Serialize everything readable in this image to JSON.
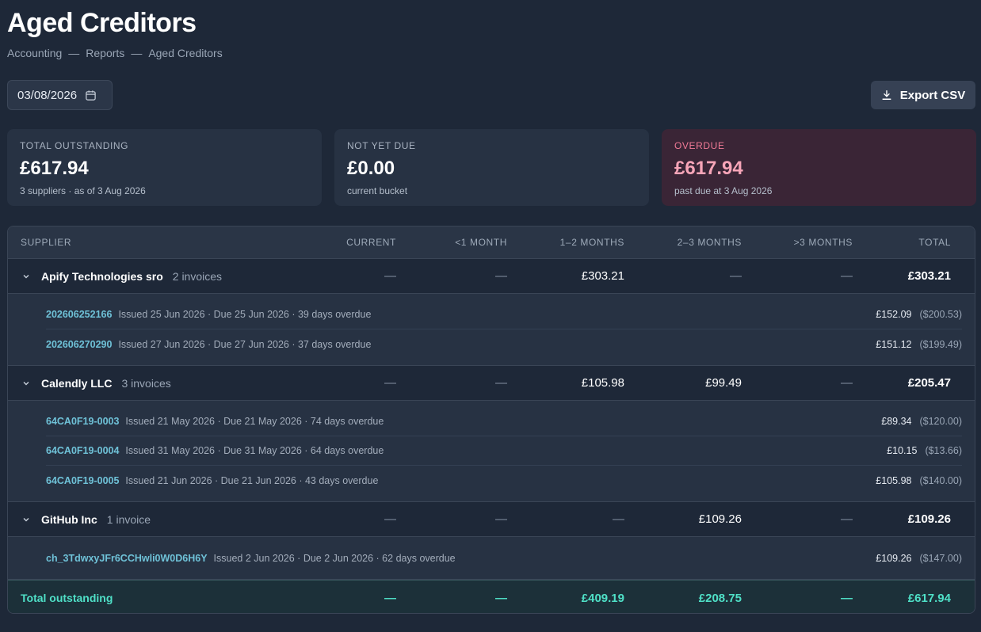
{
  "title": "Aged Creditors",
  "breadcrumb": [
    "Accounting",
    "—",
    "Reports",
    "—",
    "Aged Creditors"
  ],
  "date_value": "03/08/2026",
  "export_label": "Export CSV",
  "cards": [
    {
      "label": "TOTAL OUTSTANDING",
      "value": "£617.94",
      "sub": "3 suppliers · as of 3 Aug 2026"
    },
    {
      "label": "NOT YET DUE",
      "value": "£0.00",
      "sub": "current bucket"
    },
    {
      "label": "OVERDUE",
      "value": "£617.94",
      "sub": "past due at 3 Aug 2026"
    }
  ],
  "columns": [
    "SUPPLIER",
    "CURRENT",
    "<1 MONTH",
    "1–2 MONTHS",
    "2–3 MONTHS",
    ">3 MONTHS",
    "TOTAL"
  ],
  "groups": [
    {
      "name": "Apify Technologies sro",
      "count": "2 invoices",
      "current": "—",
      "lt1": "—",
      "m12": "£303.21",
      "m23": "—",
      "m3p": "—",
      "total": "£303.21",
      "invoices": [
        {
          "id": "202606252166",
          "meta": "Issued 25 Jun 2026 · Due 25 Jun 2026 · 39 days overdue",
          "amount": "£152.09",
          "usd": "($200.53)"
        },
        {
          "id": "202606270290",
          "meta": "Issued 27 Jun 2026 · Due 27 Jun 2026 · 37 days overdue",
          "amount": "£151.12",
          "usd": "($199.49)"
        }
      ]
    },
    {
      "name": "Calendly LLC",
      "count": "3 invoices",
      "current": "—",
      "lt1": "—",
      "m12": "£105.98",
      "m23": "£99.49",
      "m3p": "—",
      "total": "£205.47",
      "invoices": [
        {
          "id": "64CA0F19-0003",
          "meta": "Issued 21 May 2026 · Due 21 May 2026 · 74 days overdue",
          "amount": "£89.34",
          "usd": "($120.00)"
        },
        {
          "id": "64CA0F19-0004",
          "meta": "Issued 31 May 2026 · Due 31 May 2026 · 64 days overdue",
          "amount": "£10.15",
          "usd": "($13.66)"
        },
        {
          "id": "64CA0F19-0005",
          "meta": "Issued 21 Jun 2026 · Due 21 Jun 2026 · 43 days overdue",
          "amount": "£105.98",
          "usd": "($140.00)"
        }
      ]
    },
    {
      "name": "GitHub Inc",
      "count": "1 invoice",
      "current": "—",
      "lt1": "—",
      "m12": "—",
      "m23": "£109.26",
      "m3p": "—",
      "total": "£109.26",
      "invoices": [
        {
          "id": "ch_3TdwxyJFr6CCHwli0W0D6H6Y",
          "meta": "Issued 2 Jun 2026 · Due 2 Jun 2026 · 62 days overdue",
          "amount": "£109.26",
          "usd": "($147.00)"
        }
      ]
    }
  ],
  "footer": {
    "label": "Total outstanding",
    "current": "—",
    "lt1": "—",
    "m12": "£409.19",
    "m23": "£208.75",
    "m3p": "—",
    "total": "£617.94"
  },
  "colors": {
    "background": "#1e2838",
    "accent": "#4fe0c7",
    "overdue": "#f7a5b8",
    "link": "#6fc2d8"
  }
}
